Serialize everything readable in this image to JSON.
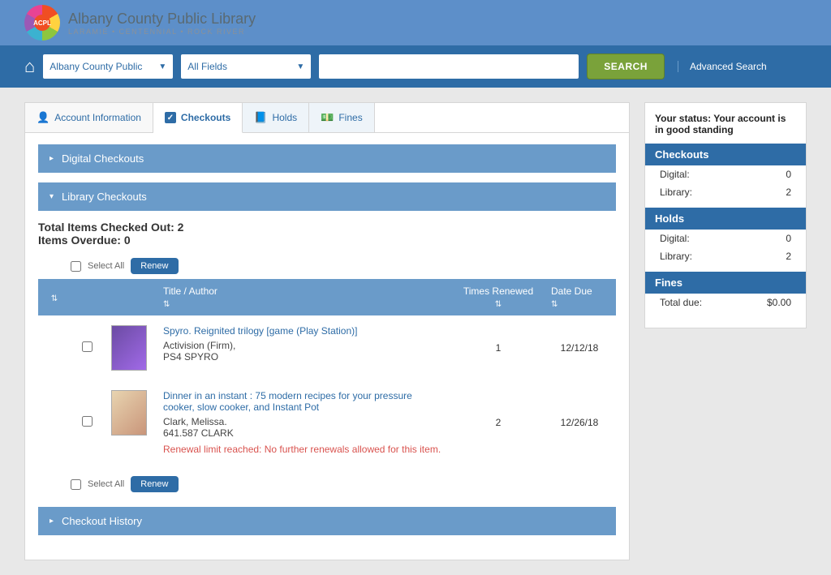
{
  "header": {
    "org_name": "Albany County Public Library",
    "org_subline": "LARAMIE • CENTENNIAL • ROCK RIVER"
  },
  "searchbar": {
    "scope_label": "Albany County Public",
    "fields_label": "All Fields",
    "search_value": "",
    "search_button": "SEARCH",
    "advanced_link": "Advanced Search"
  },
  "tabs": {
    "account": "Account Information",
    "checkouts": "Checkouts",
    "holds": "Holds",
    "fines": "Fines"
  },
  "sections": {
    "digital_checkouts": "Digital Checkouts",
    "library_checkouts": "Library Checkouts",
    "checkout_history": "Checkout History"
  },
  "checkouts_panel": {
    "total_line": "Total Items Checked Out: 2",
    "overdue_line": "Items Overdue: 0",
    "select_all_label": "Select All",
    "renew_button": "Renew",
    "columns": {
      "title_author": "Title / Author",
      "times_renewed": "Times Renewed",
      "date_due": "Date Due"
    },
    "items": [
      {
        "title": "Spyro. Reignited trilogy [game (Play Station)]",
        "author": "Activision (Firm),",
        "call": "PS4 SPYRO",
        "times_renewed": "1",
        "due": "12/12/18",
        "error": ""
      },
      {
        "title": "Dinner in an instant : 75 modern recipes for your pressure cooker, slow cooker, and Instant Pot",
        "author": "Clark, Melissa.",
        "call": "641.587 CLARK",
        "times_renewed": "2",
        "due": "12/26/18",
        "error": "Renewal limit reached: No further renewals allowed for this item."
      }
    ]
  },
  "sidebar": {
    "status_text": "Your status: Your account is in good standing",
    "sections": {
      "checkouts": {
        "label": "Checkouts",
        "digital_label": "Digital:",
        "digital_value": "0",
        "library_label": "Library:",
        "library_value": "2"
      },
      "holds": {
        "label": "Holds",
        "digital_label": "Digital:",
        "digital_value": "0",
        "library_label": "Library:",
        "library_value": "2"
      },
      "fines": {
        "label": "Fines",
        "total_due_label": "Total due:",
        "total_due_value": "$0.00"
      }
    }
  }
}
